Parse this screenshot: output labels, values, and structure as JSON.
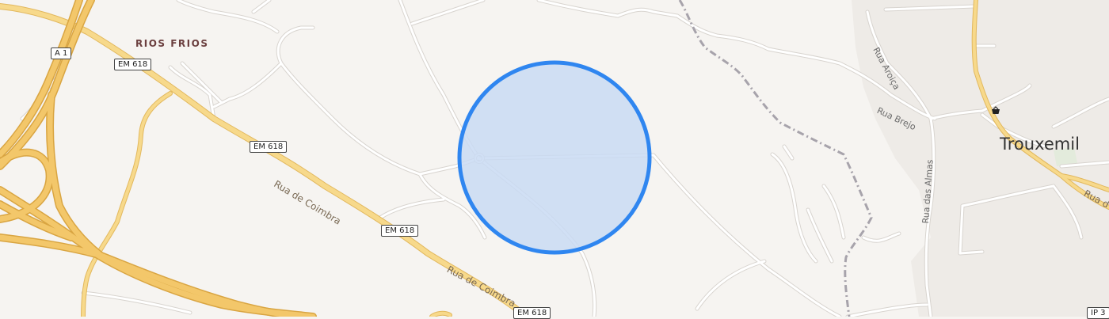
{
  "places": {
    "trouxemil": "Trouxemil",
    "rios_frios": "RIOS FRIOS"
  },
  "road_shields": [
    "A 1",
    "EM 618",
    "EM 618",
    "EM 618",
    "EM 618",
    "IP 3"
  ],
  "road_names": {
    "rua_de_coimbra_1": "Rua de Coimbra",
    "rua_de_coimbra_2": "Rua de Coimbra",
    "rua_de_truncated": "Rua d"
  },
  "streets": {
    "rua_aroica": "Rua Aroiça",
    "rua_brejo": "Rua Brejo",
    "rua_das_almas": "Rua das Almas"
  },
  "icons": {
    "poi": "shopping-basket-icon",
    "accuracy": "location-accuracy-circle"
  },
  "colors": {
    "background": "#f6f4f1",
    "urban_area": "#eeebe7",
    "minor_road": "#ffffff",
    "minor_road_casing": "#d8d4cf",
    "major_road": "#f7d98b",
    "major_road_casing": "#e2b85e",
    "motorway": "#f3c76a",
    "motorway_casing": "#d9a542",
    "railway": "#a7a3ab",
    "accuracy_fill": "#c9dbf3",
    "accuracy_stroke": "#2f86f0"
  }
}
